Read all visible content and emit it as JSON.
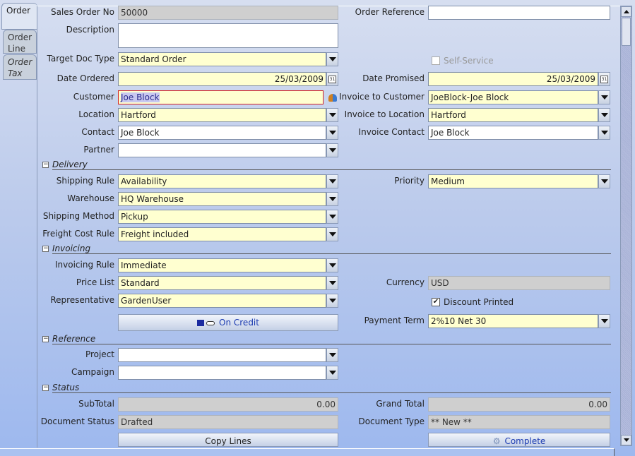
{
  "tabs": [
    {
      "label": "Order",
      "active": true
    },
    {
      "label": "Order Line"
    },
    {
      "label": "Order Tax"
    }
  ],
  "left": [
    {
      "label": "Sales Order No",
      "value": "50000",
      "type": "ro"
    },
    {
      "label": "Description",
      "value": "",
      "type": "desc"
    },
    {
      "label": "Target Doc Type",
      "value": "Standard Order",
      "type": "combo-ye"
    },
    {
      "label": "Date Ordered",
      "value": "25/03/2009",
      "type": "date"
    },
    {
      "label": "Customer",
      "value": "Joe Block",
      "type": "search"
    },
    {
      "label": "Location",
      "value": "Hartford",
      "type": "combo-ye"
    },
    {
      "label": "Contact",
      "value": "Joe Block",
      "type": "combo-wh"
    },
    {
      "label": "Partner",
      "value": "",
      "type": "combo-wh"
    },
    {
      "label": "Shipping Rule",
      "value": "Availability",
      "type": "combo-ye"
    },
    {
      "label": "Warehouse",
      "value": "HQ Warehouse",
      "type": "combo-ye"
    },
    {
      "label": "Shipping Method",
      "value": "Pickup",
      "type": "combo-ye"
    },
    {
      "label": "Freight Cost Rule",
      "value": "Freight included",
      "type": "combo-ye"
    },
    {
      "label": "Invoicing Rule",
      "value": "Immediate",
      "type": "combo-ye"
    },
    {
      "label": "Price List",
      "value": "Standard",
      "type": "combo-ye"
    },
    {
      "label": "Representative",
      "value": "GardenUser",
      "type": "combo-ye"
    },
    {
      "label": "Project",
      "value": "",
      "type": "combo-wh"
    },
    {
      "label": "Campaign",
      "value": "",
      "type": "combo-wh"
    },
    {
      "label": "SubTotal",
      "value": "0.00",
      "type": "ro-num"
    },
    {
      "label": "Document Status",
      "value": "Drafted",
      "type": "ro"
    }
  ],
  "right": [
    {
      "label": "Order Reference",
      "value": "",
      "type": "wh"
    },
    {
      "label": "Date Promised",
      "value": "25/03/2009",
      "type": "date"
    },
    {
      "label": "Invoice to Customer",
      "value": "JoeBlock-Joe Block",
      "type": "combo-ye"
    },
    {
      "label": "Invoice to Location",
      "value": "Hartford",
      "type": "combo-ye"
    },
    {
      "label": "Invoice Contact",
      "value": "Joe Block",
      "type": "combo-wh"
    },
    {
      "label": "Priority",
      "value": "Medium",
      "type": "combo-ye"
    },
    {
      "label": "Currency",
      "value": "USD",
      "type": "ro"
    },
    {
      "label": "Payment Term",
      "value": "2%10 Net 30",
      "type": "combo-ye"
    },
    {
      "label": "Grand Total",
      "value": "0.00",
      "type": "ro-num"
    },
    {
      "label": "Document Type",
      "value": "** New **",
      "type": "ro"
    }
  ],
  "checkboxes": {
    "self_service": {
      "label": "Self-Service",
      "checked": false,
      "disabled": true
    },
    "discount_printed": {
      "label": "Discount Printed",
      "checked": true
    }
  },
  "sections": [
    "Delivery",
    "Invoicing",
    "Reference",
    "Status"
  ],
  "buttons": {
    "on_credit": "On Credit",
    "copy_lines": "Copy Lines",
    "complete": "Complete"
  },
  "icons": {
    "calendar": "calendar-icon",
    "customer_lookup": "people-icon",
    "on_credit": "hand-card-icon",
    "complete": "gear-icon"
  }
}
